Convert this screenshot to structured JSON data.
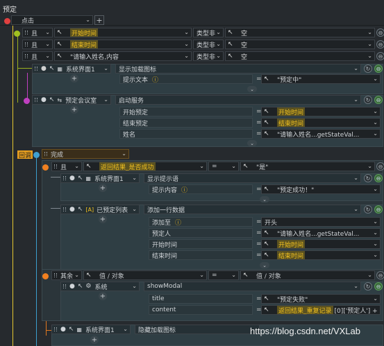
{
  "header": {
    "title": "预定"
  },
  "trigger": {
    "event": "点击"
  },
  "conditions": [
    {
      "op": "且",
      "field": "开始时间",
      "cmp": "类型非",
      "value": "空"
    },
    {
      "op": "且",
      "field": "结束时间",
      "cmp": "类型非",
      "value": "空"
    },
    {
      "op": "且",
      "field": "\"请输入姓名,内容",
      "cmp": "类型非",
      "value": "空"
    }
  ],
  "action1": {
    "target": "系统界面1",
    "method": "显示加载图标",
    "param_label": "提示文本",
    "param_value": "\"预定中\""
  },
  "action2": {
    "target": "预定会议室",
    "method": "启动服务",
    "params": [
      {
        "label": "开始预定",
        "value": "开始时间"
      },
      {
        "label": "结束预定",
        "value": "结束时间"
      },
      {
        "label": "姓名",
        "value": "\"请输入姓名...getStateVal..."
      }
    ]
  },
  "callback": {
    "badge": "回调",
    "name": "完成"
  },
  "if_block": {
    "op": "且",
    "field": "返回结果_是否成功",
    "cmp": "=",
    "value": "\"是\""
  },
  "action3": {
    "target": "系统界面1",
    "method": "显示提示语",
    "param_label": "提示内容",
    "param_value": "\"预定成功！\""
  },
  "action4": {
    "target": "已预定列表",
    "method": "添加一行数据",
    "params": [
      {
        "label": "添加至",
        "value": "开头"
      },
      {
        "label": "预定人",
        "value": "\"请输入姓名...getStateVal..."
      },
      {
        "label": "开始时间",
        "value": "开始时间"
      },
      {
        "label": "结束时间",
        "value": "结束时间"
      }
    ]
  },
  "else_block": {
    "op": "其余",
    "field": "值 / 对象",
    "cmp": "=",
    "value": "值 / 对象"
  },
  "action5": {
    "target": "系统",
    "method": "showModal",
    "params": [
      {
        "label": "title",
        "value": "\"预定失败\""
      },
      {
        "label": "content",
        "value": "返回结果_重复记录",
        "suffix": "[0]['预定人'] + '已预定"
      }
    ]
  },
  "action6": {
    "target": "系统界面1",
    "method": "隐藏加载图标"
  },
  "watermark": "https://blog.csdn.net/VXLab",
  "colors": {
    "accent_yellow": "#f0c020",
    "trigger_red": "#e04040",
    "condition_green": "#a0c020",
    "service_pink": "#c040c0",
    "callback_cyan": "#40a0d0",
    "if_orange": "#f08020"
  }
}
